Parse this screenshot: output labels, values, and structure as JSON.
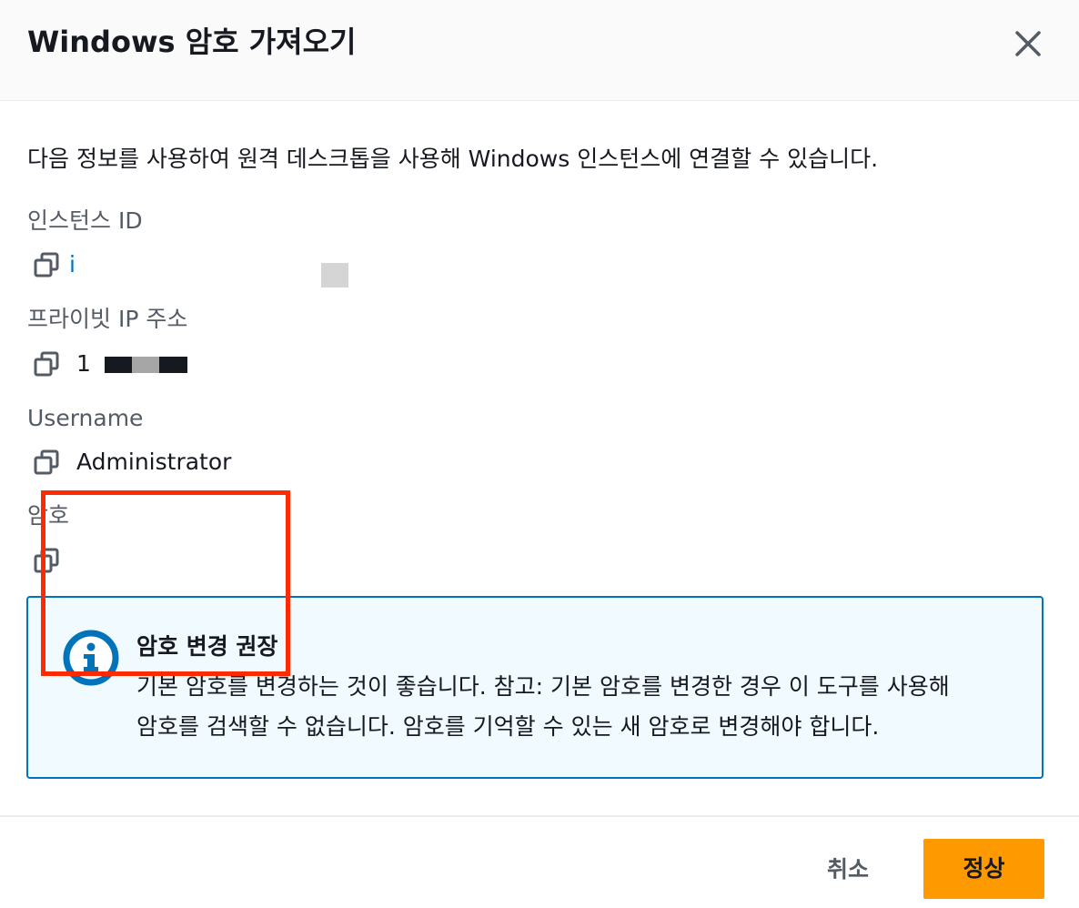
{
  "modal": {
    "title": "Windows 암호 가져오기",
    "description": "다음 정보를 사용하여 원격 데스크톱을 사용해 Windows 인스턴스에 연결할 수 있습니다."
  },
  "fields": {
    "instance_id": {
      "label": "인스턴스 ID",
      "value": "i"
    },
    "private_ip": {
      "label": "프라이빗 IP 주소",
      "value": "1"
    },
    "username": {
      "label": "Username",
      "value": "Administrator"
    },
    "password": {
      "label": "암호",
      "value": ""
    }
  },
  "alert": {
    "type": "info",
    "title": "암호 변경 권장",
    "body_line1": "기본 암호를 변경하는 것이 좋습니다. 참고: 기본 암호를 변경한 경우 이 도구를 사용해",
    "body_line2": "암호를 검색할 수 없습니다. 암호를 기억할 수 있는 새 암호로 변경해야 합니다."
  },
  "footer": {
    "cancel_label": "취소",
    "primary_label": "정상"
  },
  "colors": {
    "primary": "#ff9900",
    "link": "#0073bb",
    "info_bg": "#f1faff",
    "highlight": "#ff2a00"
  },
  "icons": {
    "close": "close-icon",
    "copy": "copy-icon",
    "info": "info-icon"
  }
}
